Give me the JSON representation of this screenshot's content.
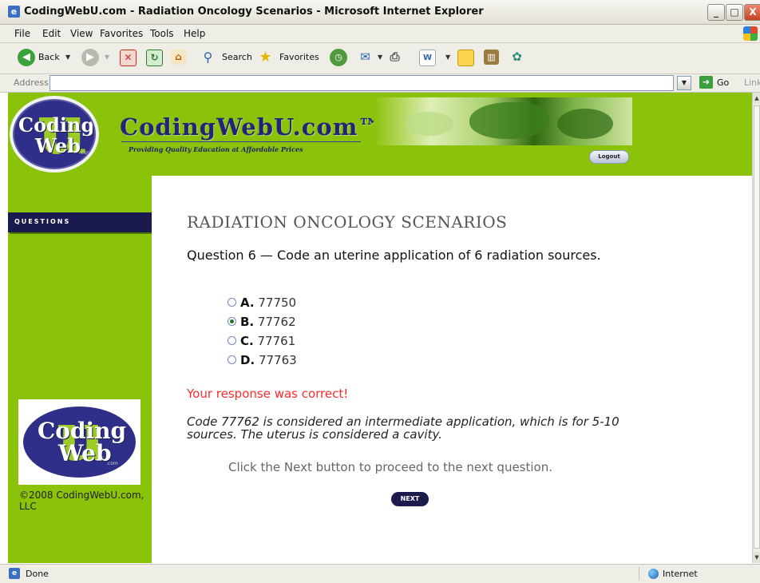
{
  "window": {
    "title": "CodingWebU.com - Radiation Oncology Scenarios - Microsoft Internet Explorer",
    "controls": {
      "minimize": "_",
      "maximize": "□",
      "close": "X"
    }
  },
  "menu": [
    "File",
    "Edit",
    "View",
    "Favorites",
    "Tools",
    "Help"
  ],
  "toolbar": {
    "back": "Back",
    "search": "Search",
    "favorites": "Favorites"
  },
  "address": {
    "label": "Address",
    "value": "",
    "go": "Go",
    "links": "Link"
  },
  "header": {
    "logo_top": "Coding",
    "logo_bottom": "Web",
    "logo_small": ".com",
    "site_name": "CodingWebU.com™",
    "tagline": "Providing Quality Education at Affordable Prices",
    "logout": "Logout"
  },
  "sidebar": {
    "tab": "QUESTIONS",
    "copyright": "©2008 CodingWebU.com, LLC"
  },
  "main": {
    "title": "RADIATION ONCOLOGY SCENARIOS",
    "question": "Question 6 — Code an uterine application of 6 radiation sources.",
    "options": [
      {
        "letter": "A.",
        "value": "77750",
        "selected": false
      },
      {
        "letter": "B.",
        "value": "77762",
        "selected": true
      },
      {
        "letter": "C.",
        "value": "77761",
        "selected": false
      },
      {
        "letter": "D.",
        "value": "77763",
        "selected": false
      }
    ],
    "result": "Your response was correct!",
    "explanation": "Code 77762 is considered an intermediate application, which is for 5-10 sources. The uterus is considered a cavity.",
    "instruction": "Click the Next button to proceed to the next question.",
    "next": "NEXT"
  },
  "status": {
    "text": "Done",
    "zone": "Internet"
  },
  "colors": {
    "page_green": "#8bc20a",
    "navy": "#1a1a4e",
    "result_red": "#ff2a2a"
  }
}
